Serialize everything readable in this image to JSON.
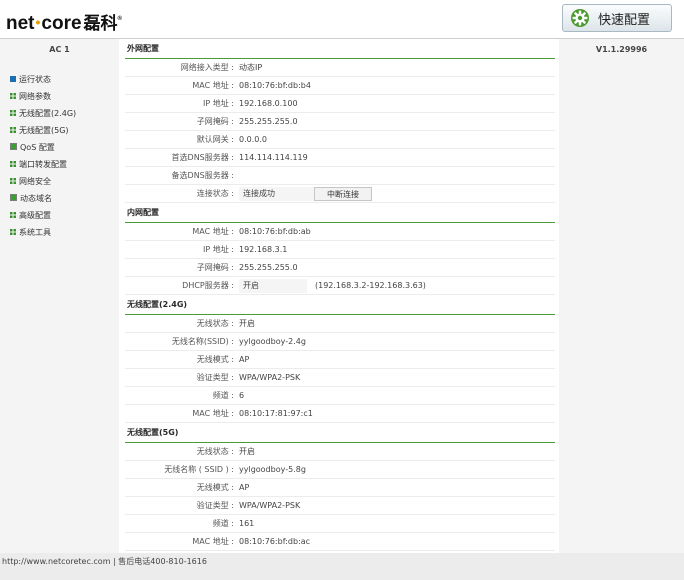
{
  "header": {
    "logo_word": "net",
    "logo_word2": "core",
    "logo_cn": "磊科",
    "logo_reg": "®",
    "quick_config_label": "快速配置"
  },
  "sidebar": {
    "title": "AC 1",
    "items": [
      {
        "label": "运行状态",
        "icon": "square-icon"
      },
      {
        "label": "网络参数",
        "icon": "grid-icon"
      },
      {
        "label": "无线配置(2.4G)",
        "icon": "grid-icon"
      },
      {
        "label": "无线配置(5G)",
        "icon": "grid-icon"
      },
      {
        "label": "QoS 配置",
        "icon": "green-square-icon"
      },
      {
        "label": "端口转发配置",
        "icon": "grid-icon"
      },
      {
        "label": "网络安全",
        "icon": "grid-icon"
      },
      {
        "label": "动态域名",
        "icon": "green-square-icon"
      },
      {
        "label": "高级配置",
        "icon": "grid-icon"
      },
      {
        "label": "系统工具",
        "icon": "grid-icon"
      }
    ]
  },
  "version": "V1.1.29996",
  "wan": {
    "title": "外网配置",
    "rows": [
      {
        "label": "网络接入类型 :",
        "value": "动态IP"
      },
      {
        "label": "MAC 地址 :",
        "value": "08:10:76:bf:db:b4"
      },
      {
        "label": "IP 地址 :",
        "value": "192.168.0.100"
      },
      {
        "label": "子网掩码 :",
        "value": "255.255.255.0"
      },
      {
        "label": "默认网关 :",
        "value": "0.0.0.0"
      },
      {
        "label": "首选DNS服务器 :",
        "value": "114.114.114.119"
      },
      {
        "label": "备选DNS服务器 :",
        "value": ""
      }
    ],
    "status_label": "连接状态 :",
    "status_value": "连接成功",
    "disconnect_label": "中断连接"
  },
  "lan": {
    "title": "内网配置",
    "rows": [
      {
        "label": "MAC 地址 :",
        "value": "08:10:76:bf:db:ab"
      },
      {
        "label": "IP 地址 :",
        "value": "192.168.3.1"
      },
      {
        "label": "子网掩码 :",
        "value": "255.255.255.0"
      }
    ],
    "dhcp_label": "DHCP服务器 :",
    "dhcp_value": "开启",
    "dhcp_range": "(192.168.3.2-192.168.3.63)"
  },
  "wifi24": {
    "title": "无线配置(2.4G)",
    "rows": [
      {
        "label": "无线状态 :",
        "value": "开启"
      },
      {
        "label": "无线名称(SSID) :",
        "value": "yylgoodboy-2.4g"
      },
      {
        "label": "无线模式 :",
        "value": "AP"
      },
      {
        "label": "验证类型 :",
        "value": "WPA/WPA2-PSK"
      },
      {
        "label": "频道 :",
        "value": "6"
      },
      {
        "label": "MAC 地址 :",
        "value": "08:10:17:81:97:c1"
      }
    ]
  },
  "wifi5": {
    "title": "无线配置(5G)",
    "rows": [
      {
        "label": "无线状态 :",
        "value": "开启"
      },
      {
        "label": "无线名称 ( SSID ) :",
        "value": "yylgoodboy-5.8g"
      },
      {
        "label": "无线模式 :",
        "value": "AP"
      },
      {
        "label": "验证类型 :",
        "value": "WPA/WPA2-PSK"
      },
      {
        "label": "频道 :",
        "value": "161"
      },
      {
        "label": "MAC 地址 :",
        "value": "08:10:76:bf:db:ac"
      }
    ]
  },
  "footer": {
    "text": "http://www.netcoretec.com | 售后电话400-810-1616"
  }
}
